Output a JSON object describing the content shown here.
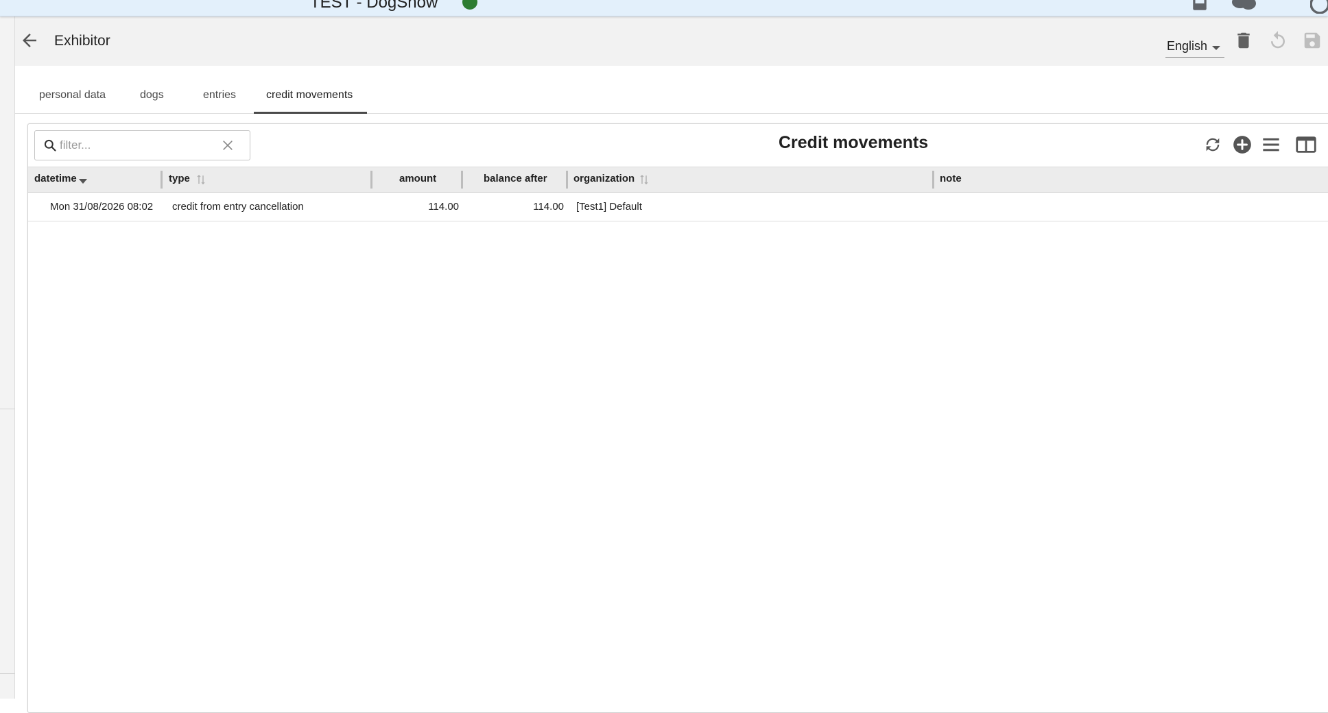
{
  "app": {
    "title": "TEST - DogShow"
  },
  "header": {
    "title": "Exhibitor",
    "language": "English"
  },
  "tabs": [
    {
      "label": "personal data"
    },
    {
      "label": "dogs"
    },
    {
      "label": "entries"
    },
    {
      "label": "credit movements",
      "active": true
    }
  ],
  "table": {
    "title": "Credit movements",
    "filter_placeholder": "filter...",
    "columns": [
      "datetime",
      "type",
      "amount",
      "balance after",
      "organization",
      "note"
    ],
    "rows": [
      {
        "datetime": "Mon 31/08/2026 08:02",
        "type": "credit from entry cancellation",
        "amount": "114.00",
        "balance_after": "114.00",
        "organization": "[Test1] Default",
        "note": ""
      }
    ]
  },
  "icons": {
    "back": "arrow-left-icon",
    "delete": "trash-icon",
    "undo": "undo-icon",
    "save": "save-icon",
    "refresh": "refresh-icon",
    "add": "add-circle-icon",
    "menu": "menu-icon",
    "columns": "columns-icon",
    "search": "search-icon",
    "clear": "close-icon"
  },
  "colors": {
    "status_ok": "#2e7d32",
    "topbar": "#e3f0fb",
    "header_bg": "#f2f2f2"
  }
}
